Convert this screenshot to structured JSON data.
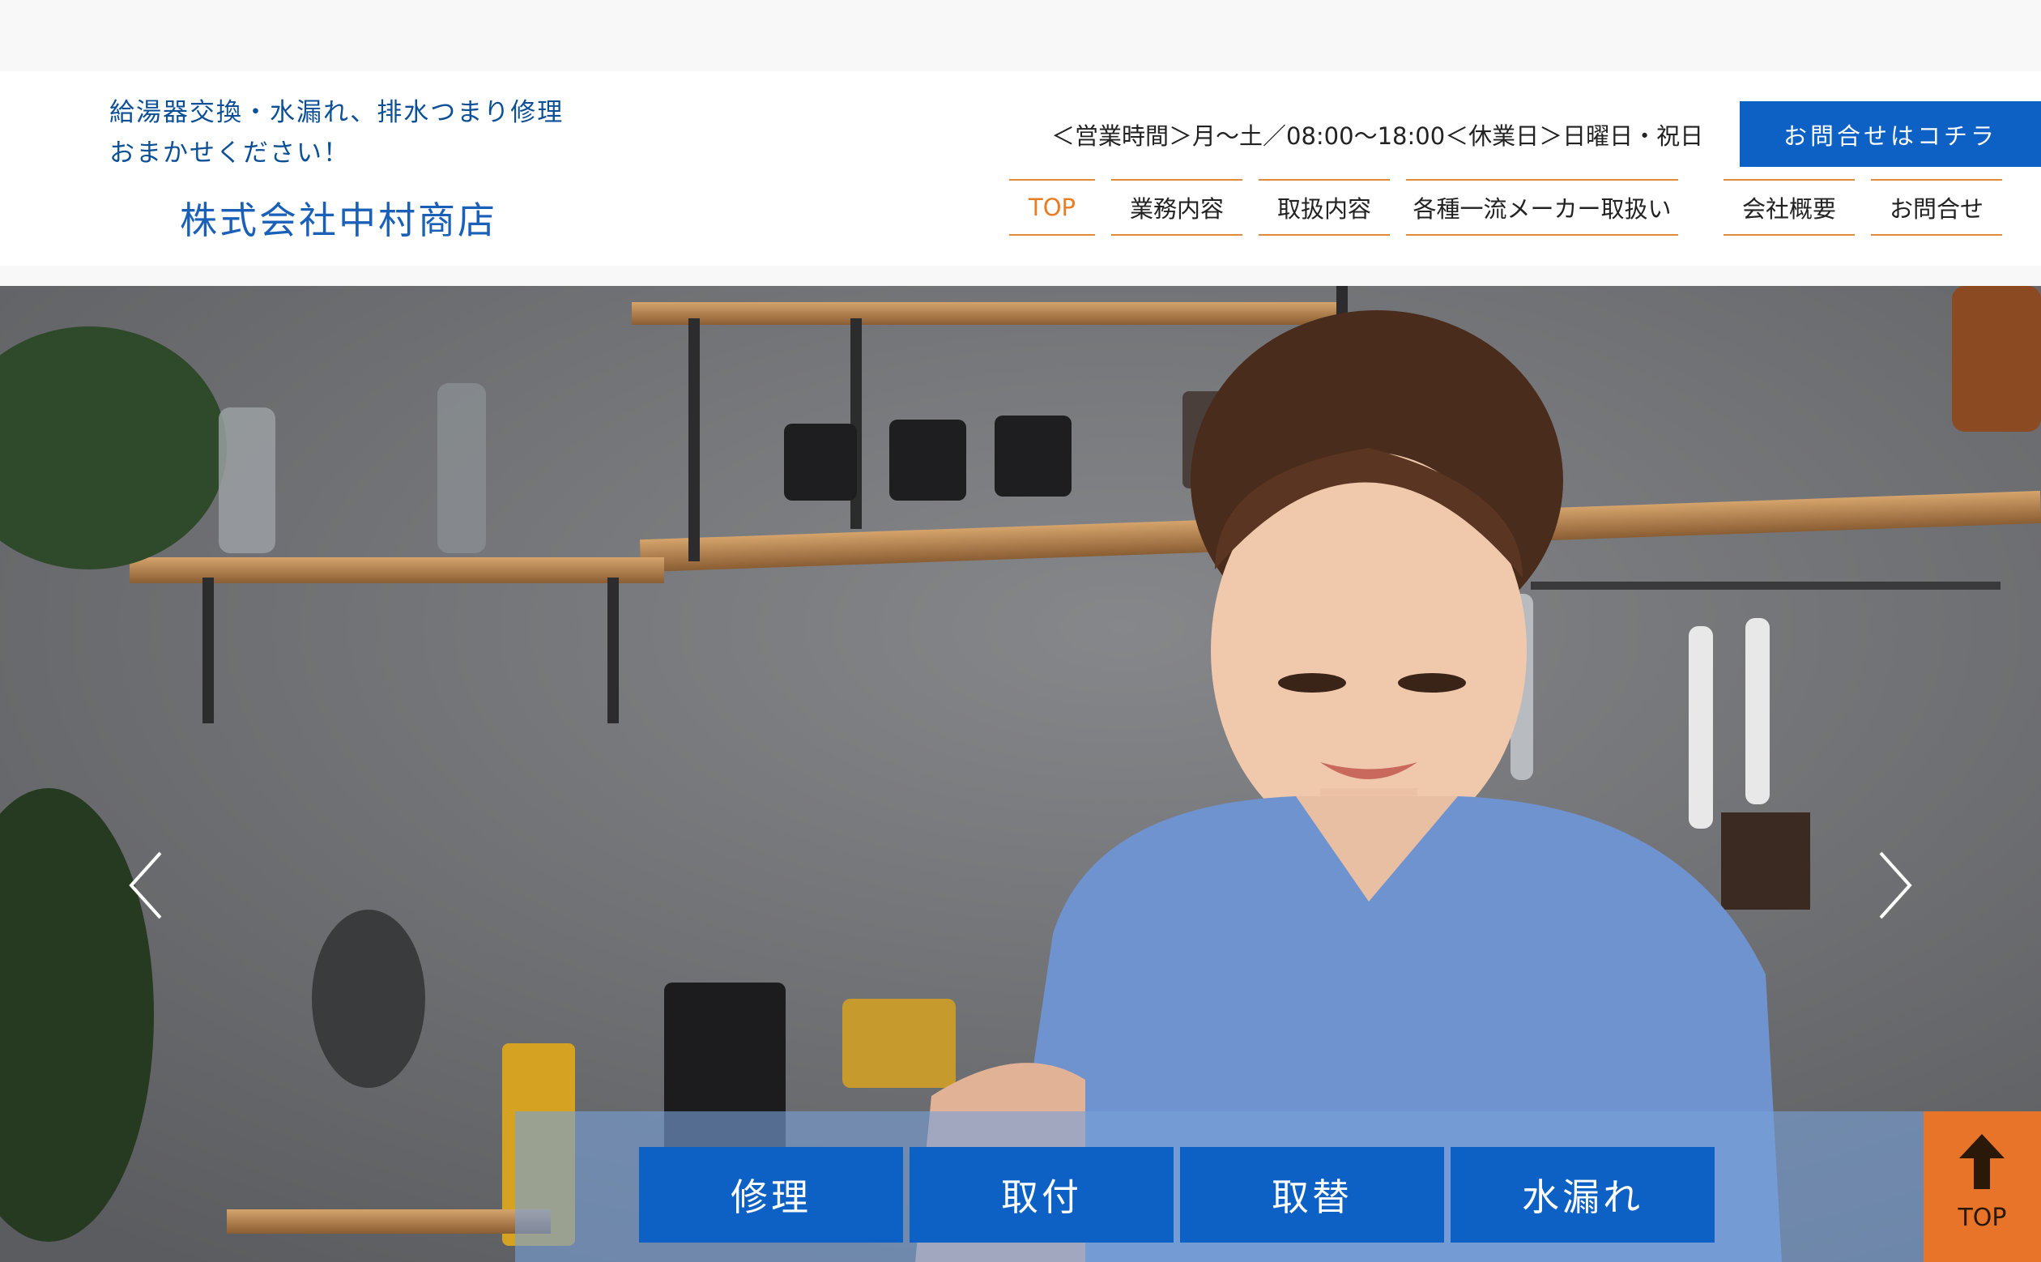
{
  "header": {
    "tagline": [
      "給湯器交換・水漏れ、排水つまり修理",
      "おまかせください！"
    ],
    "company_name": "株式会社中村商店",
    "business_hours": "＜営業時間＞月～土／08:00～18:00＜休業日＞日曜日・祝日",
    "contact_button": "お問合せはコチラ"
  },
  "nav": {
    "items": [
      {
        "label": "TOP",
        "active": true
      },
      {
        "label": "業務内容",
        "active": false
      },
      {
        "label": "取扱内容",
        "active": false
      },
      {
        "label": "各種一流メーカー取扱い",
        "active": false
      },
      {
        "label": "会社概要",
        "active": false
      },
      {
        "label": "お問合せ",
        "active": false
      }
    ]
  },
  "hero": {
    "prev_icon": "chevron-left-icon",
    "next_icon": "chevron-right-icon"
  },
  "services": {
    "buttons": [
      "修理",
      "取付",
      "取替",
      "水漏れ"
    ]
  },
  "back_to_top": {
    "label": "TOP",
    "icon": "arrow-up-icon"
  },
  "colors": {
    "brand_blue": "#0d61c4",
    "accent_orange": "#e8742a",
    "nav_active": "#e87d24"
  }
}
